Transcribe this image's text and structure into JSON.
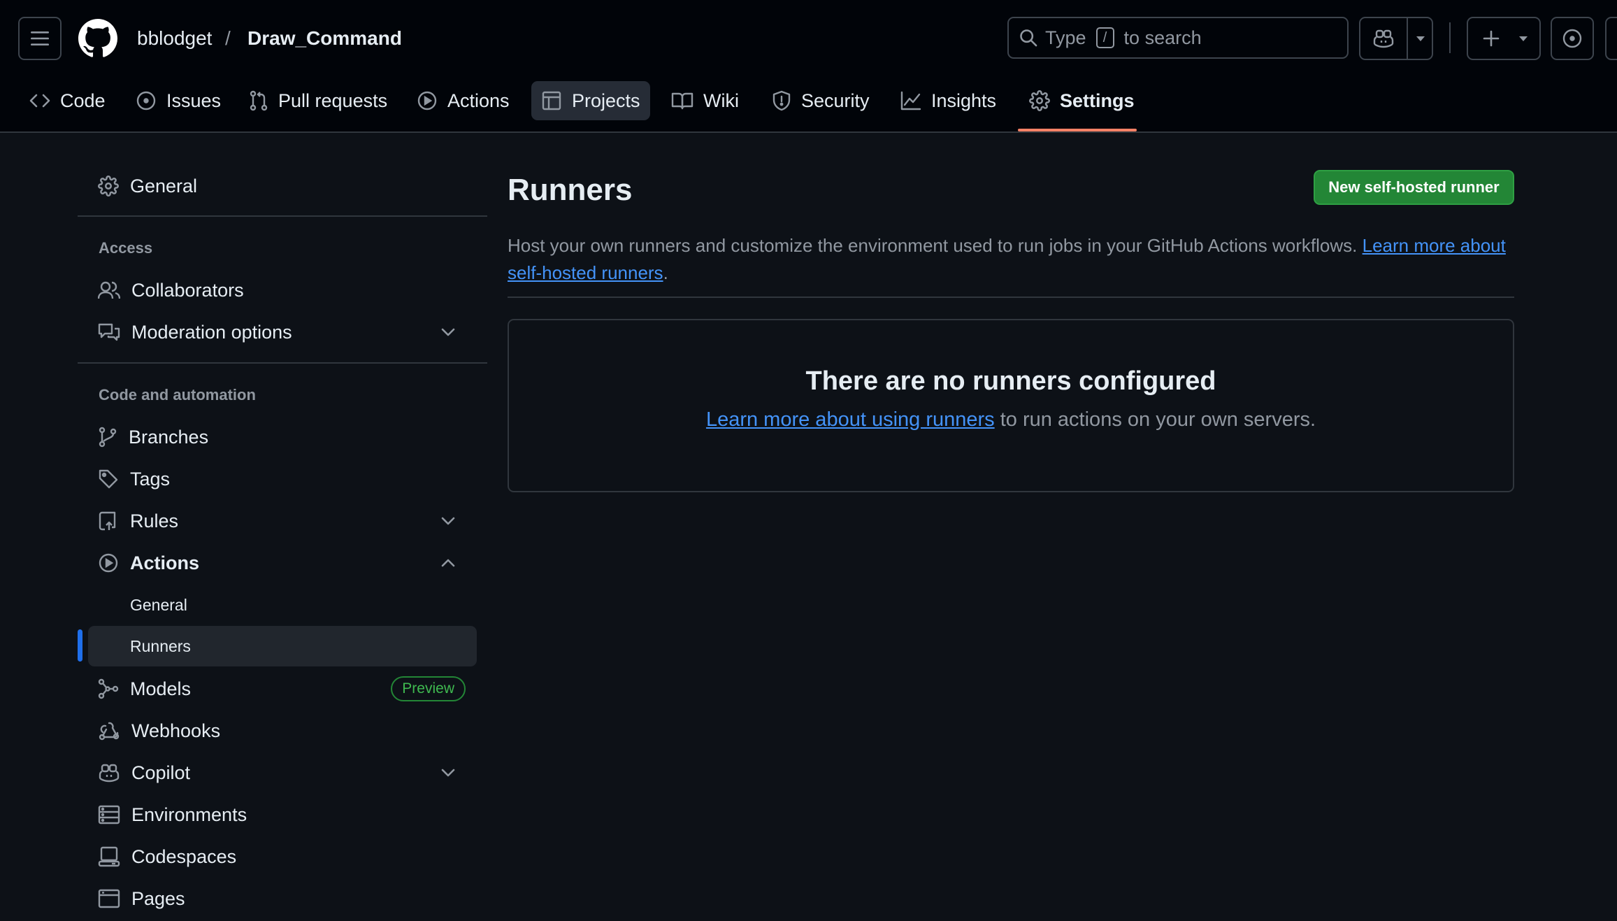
{
  "header": {
    "owner": "bblodget",
    "separator": "/",
    "repo": "Draw_Command",
    "search": {
      "prefix": "Type",
      "key": "/",
      "suffix": "to search"
    }
  },
  "tabs": [
    {
      "label": "Code",
      "icon": "code-icon"
    },
    {
      "label": "Issues",
      "icon": "issue-opened-icon"
    },
    {
      "label": "Pull requests",
      "icon": "git-pull-request-icon"
    },
    {
      "label": "Actions",
      "icon": "play-icon"
    },
    {
      "label": "Projects",
      "icon": "table-icon"
    },
    {
      "label": "Wiki",
      "icon": "book-icon"
    },
    {
      "label": "Security",
      "icon": "shield-icon"
    },
    {
      "label": "Insights",
      "icon": "graph-icon"
    },
    {
      "label": "Settings",
      "icon": "gear-icon"
    }
  ],
  "sidebar": {
    "general": "General",
    "access_heading": "Access",
    "collaborators": "Collaborators",
    "moderation": "Moderation options",
    "code_heading": "Code and automation",
    "branches": "Branches",
    "tags": "Tags",
    "rules": "Rules",
    "actions": "Actions",
    "actions_general": "General",
    "actions_runners": "Runners",
    "models": "Models",
    "models_badge": "Preview",
    "webhooks": "Webhooks",
    "copilot": "Copilot",
    "environments": "Environments",
    "codespaces": "Codespaces",
    "pages": "Pages"
  },
  "main": {
    "title": "Runners",
    "new_button": "New self-hosted runner",
    "description": "Host your own runners and customize the environment used to run jobs in your GitHub Actions workflows.",
    "description_link": "Learn more about self-hosted runners",
    "description_end": ".",
    "empty_title": "There are no runners configured",
    "empty_link": "Learn more about using runners",
    "empty_rest": "to run actions on your own servers."
  },
  "colors": {
    "background": "#0d1117",
    "header_bg": "#010409",
    "accent_link": "#4493f8",
    "primary_button": "#238636",
    "selected_tab_underline": "#f78166",
    "active_nav_bar": "#1f6feb"
  }
}
